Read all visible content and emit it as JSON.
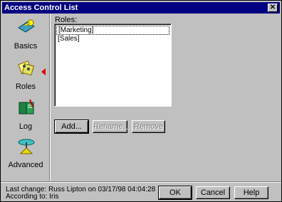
{
  "window": {
    "title": "Access Control List"
  },
  "sidebar": {
    "items": [
      {
        "label": "Basics",
        "icon": "key-icon"
      },
      {
        "label": "Roles",
        "icon": "roles-icon"
      },
      {
        "label": "Log",
        "icon": "log-book-icon"
      },
      {
        "label": "Advanced",
        "icon": "advanced-icon"
      }
    ],
    "selected": "Roles"
  },
  "roles": {
    "label": "Roles:",
    "items": [
      "[Marketing]",
      "[Sales]"
    ]
  },
  "buttons": {
    "add": "Add...",
    "rename": "Rename...",
    "remove": "Remove",
    "ok": "OK",
    "cancel": "Cancel",
    "help": "Help"
  },
  "status": {
    "last_change": "Last change:  Russ Lipton on 03/17/98 04:04:28",
    "according_to": "According to: Iris"
  },
  "colors": {
    "titlebar": "#000080",
    "face": "#c0c0c0",
    "selected_arrow": "#e00000"
  }
}
